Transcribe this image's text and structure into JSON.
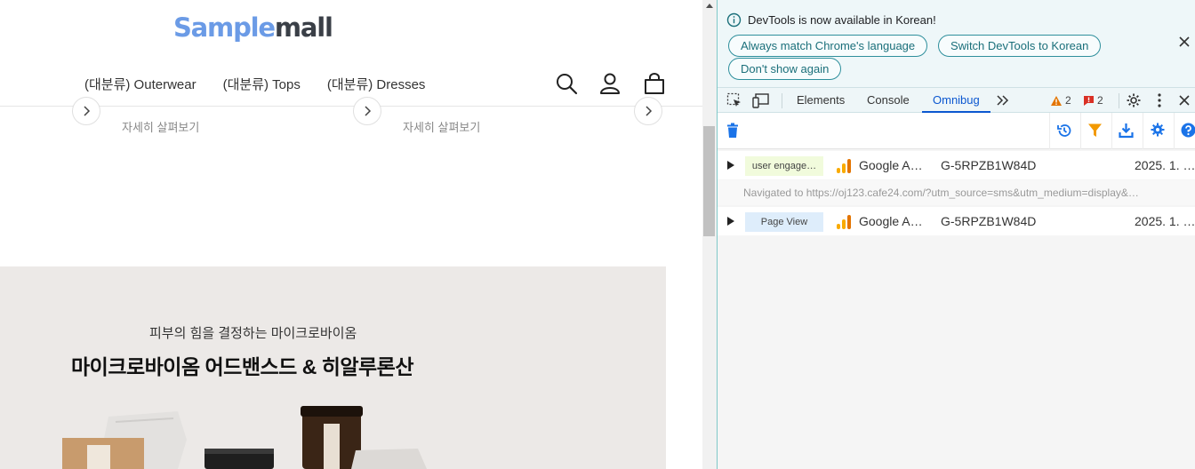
{
  "site": {
    "logo_part1": "Sample",
    "logo_part2": "mall",
    "nav": [
      "(대분류) Outerwear",
      "(대분류) Tops",
      "(대분류) Dresses"
    ],
    "detail_label": "자세히 살펴보기",
    "banner_subtitle": "피부의 힘을 결정하는 마이크로바이옴",
    "banner_title": "마이크로바이옴 어드밴스드 & 히알루론산"
  },
  "devtools": {
    "notice": {
      "message": "DevTools is now available in Korean!",
      "btn_match": "Always match Chrome's language",
      "btn_switch": "Switch DevTools to Korean",
      "btn_dont_show": "Don't show again"
    },
    "tabs": [
      "Elements",
      "Console",
      "Omnibug"
    ],
    "active_tab": "Omnibug",
    "warnings_count": "2",
    "issues_count": "2",
    "rows": [
      {
        "tag": "user engage…",
        "tag_color": "#f1fbdc",
        "vendor": "Google A…",
        "account": "G-5RPZB1W84D",
        "date": "2025. 1. …"
      },
      {
        "tag": "Page View",
        "tag_color": "#deedfb",
        "vendor": "Google A…",
        "account": "G-5RPZB1W84D",
        "date": "2025. 1. …"
      }
    ],
    "navigated_text": "Navigated to https://oj123.cafe24.com/?utm_source=sms&utm_medium=display&…"
  },
  "colors": {
    "accent_blue": "#0b57d0",
    "teal": "#1a6f7a",
    "logo_blue": "#6b9be6",
    "banner_bg": "#ece9e7"
  }
}
